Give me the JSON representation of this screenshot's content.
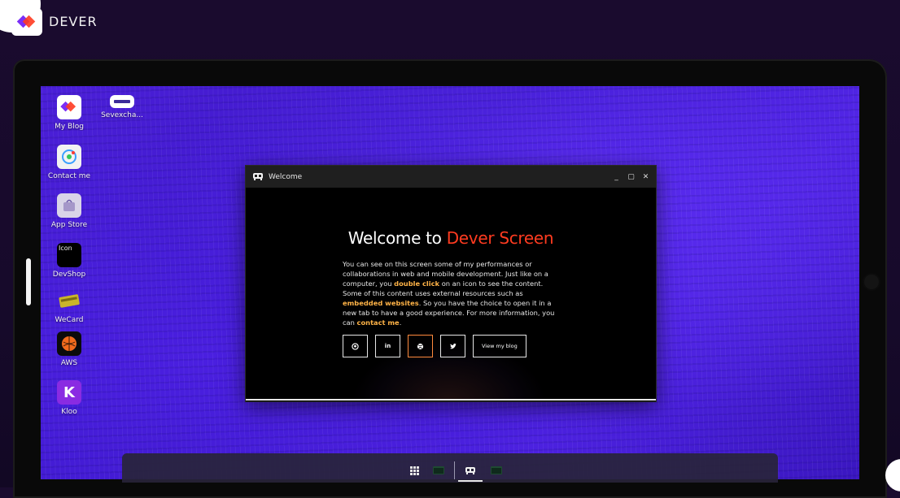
{
  "brand": {
    "name": "DEVER"
  },
  "desktop": {
    "icons": [
      {
        "label": "My Blog",
        "icon": "dever-logo-icon"
      },
      {
        "label": "Sevexcha...",
        "icon": "sevexchange-icon"
      },
      {
        "label": "Contact me",
        "icon": "contact-icon"
      },
      {
        "label": "App Store",
        "icon": "app-store-icon"
      },
      {
        "label": "DevShop",
        "icon": "devshop-broken-image-icon",
        "alt_text": "Icon"
      },
      {
        "label": "WeCard",
        "icon": "wecard-icon"
      },
      {
        "label": "AWS",
        "icon": "aws-icon"
      },
      {
        "label": "Kloo",
        "icon": "kloo-icon",
        "glyph": "K"
      }
    ]
  },
  "window": {
    "title": "Welcome",
    "controls": {
      "minimize": "_",
      "maximize": "▢",
      "close": "✕"
    },
    "heading": {
      "prefix": "Welcome to ",
      "accent": "Dever Screen"
    },
    "paragraph": {
      "p1": "You can see on this screen some of my performances or collaborations in web and mobile development. Just like on a computer, you ",
      "h1": "double click",
      "p2": " on an icon to see the content. Some of this content uses external resources such as ",
      "h2": "embedded websites",
      "p3": ". So you have the choice to open it in a new tab to have a good experience. For more information, you can ",
      "h3": "contact me",
      "p4": "."
    },
    "social_buttons": [
      "github-icon",
      "linkedin-icon",
      "dribbble-icon",
      "twitter-icon"
    ],
    "blog_button": "View my blog"
  },
  "colors": {
    "accent": "#ff3b20",
    "highlight": "#ffb347",
    "desktop": "#4b1fd8"
  }
}
